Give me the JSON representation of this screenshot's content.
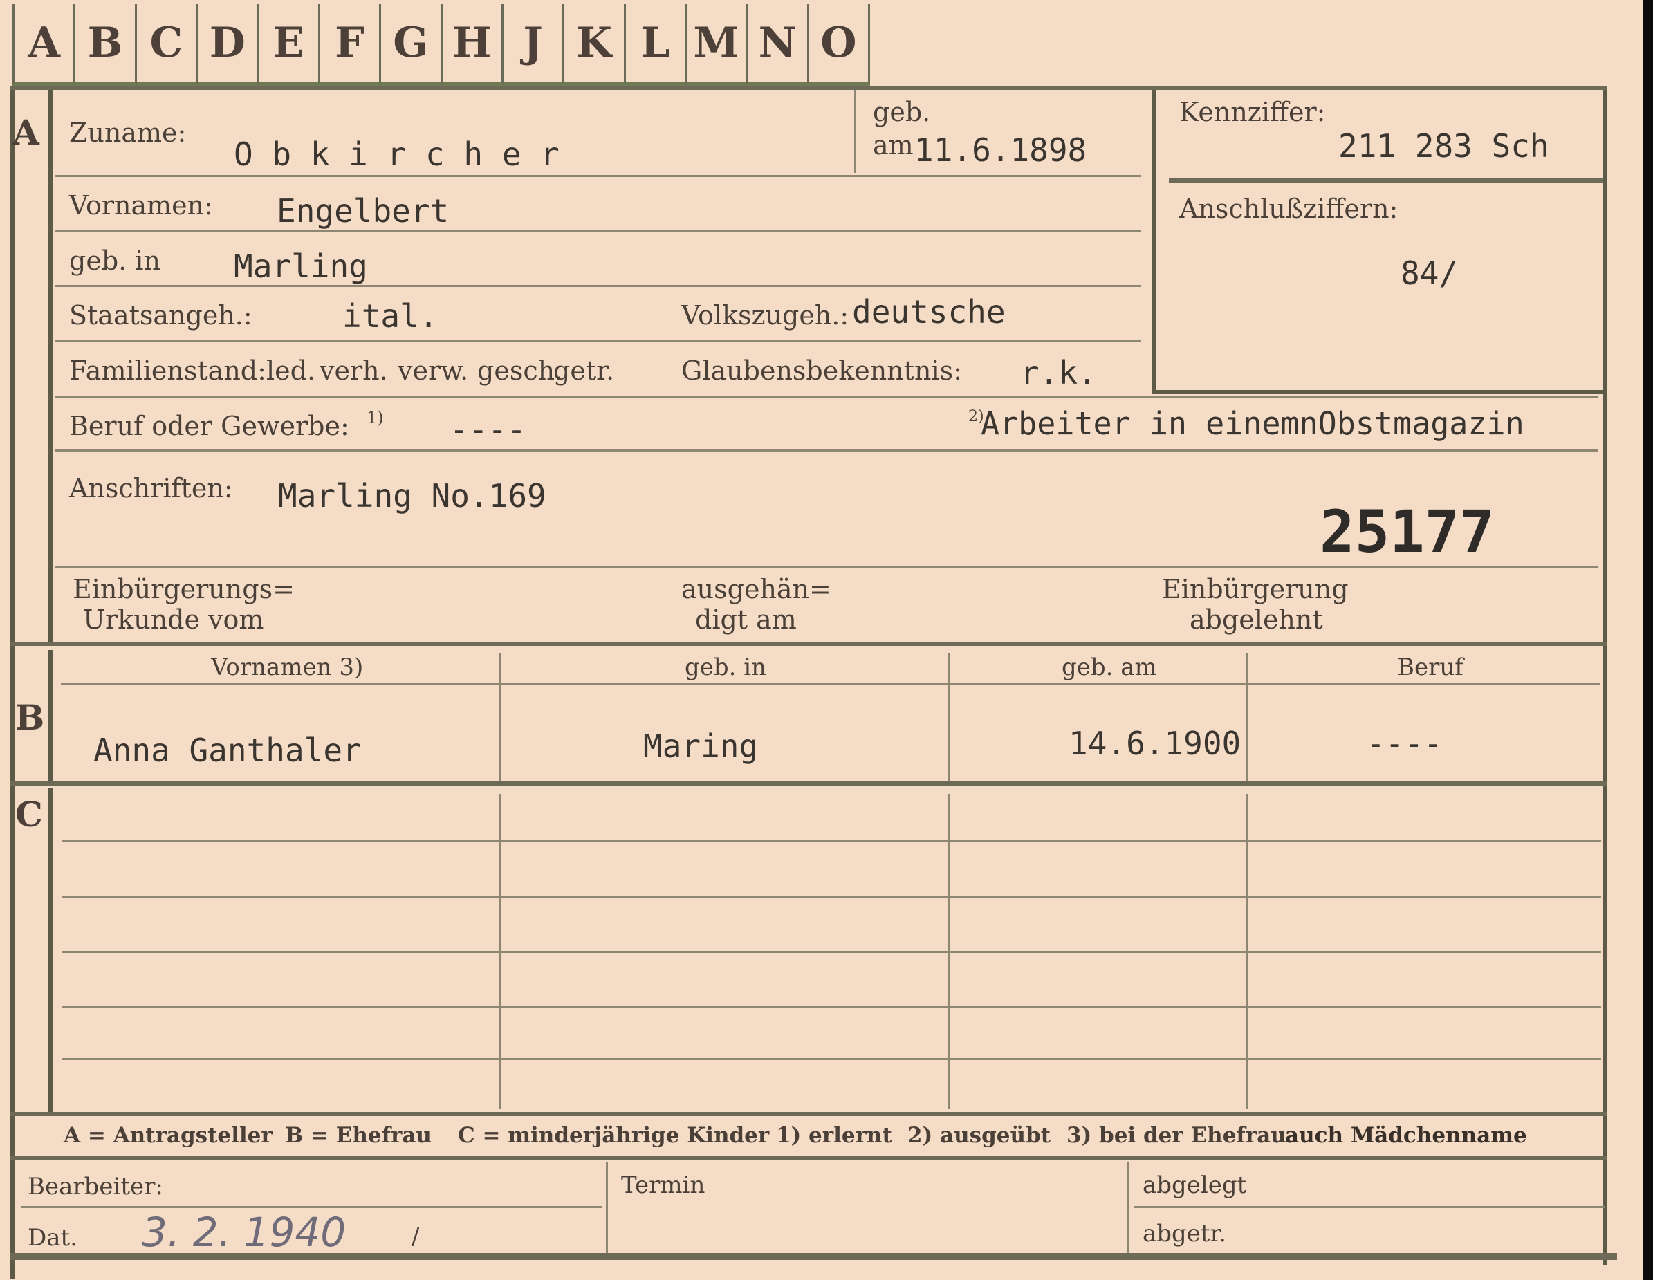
{
  "tabs": [
    "A",
    "B",
    "C",
    "D",
    "E",
    "F",
    "G",
    "H",
    "J",
    "K",
    "L",
    "M",
    "N",
    "O"
  ],
  "section_markers": {
    "a": "A",
    "b": "B",
    "c": "C"
  },
  "fields": {
    "zuname_label": "Zuname:",
    "zuname_value": "O b k i r c h e r",
    "geb_label": "geb.",
    "am_label": "am",
    "geb_am_value": "11.6.1898",
    "kennziffer_label": "Kennziffer:",
    "kennziffer_value": "211 283  Sch",
    "vornamen_label": "Vornamen:",
    "vornamen_value": "Engelbert",
    "anschlussziffern_label": "Anschlußziffern:",
    "anschlussziffern_value": "84/",
    "geb_in_label": "geb. in",
    "geb_in_value": "Marling",
    "staatsangeh_label": "Staatsangeh.:",
    "staatsangeh_value": "ital.",
    "volkszugeh_label": "Volkszugeh.:",
    "volkszugeh_value": "deutsche",
    "familienstand_label": "Familienstand:",
    "familienstand_options": [
      "led.",
      "verh.",
      "verw.",
      "gesch.",
      "getr."
    ],
    "glaubensbekenntnis_label": "Glaubensbekenntnis:",
    "glaubensbekenntnis_value": "r.k.",
    "beruf_label": "Beruf oder Gewerbe:",
    "footnote_1": "1)",
    "beruf_erlernt_value": "----",
    "footnote_2": "2)",
    "beruf_ausgeuebt_value": "Arbeiter in einemnObstmagazin",
    "anschriften_label": "Anschriften:",
    "anschriften_value": "Marling No.169",
    "stamp_number": "25177",
    "einbuergerungsurkunde_line1": "Einbürgerungs=",
    "einbuergerungsurkunde_line2": "Urkunde vom",
    "ausgehaendigt_line1": "ausgehän=",
    "ausgehaendigt_line2": "digt am",
    "einbuergerung_abgelehnt_line1": "Einbürgerung",
    "einbuergerung_abgelehnt_line2": "abgelehnt"
  },
  "table": {
    "headers": [
      "Vornamen 3)",
      "geb. in",
      "geb. am",
      "Beruf"
    ],
    "row_b": {
      "name": "Anna  Ganthaler",
      "geb_in": "Maring",
      "geb_am": "14.6.1900",
      "beruf": "----"
    }
  },
  "legend": {
    "a": "A = Antragsteller",
    "b": "B = Ehefrau",
    "c": "C = minderjährige Kinder",
    "f1": "1) erlernt",
    "f2": "2) ausgeübt",
    "f3_prefix": "3) bei der Ehefrau",
    "f3_suffix": "auch Mädchenname"
  },
  "bottom": {
    "bearbeiter_label": "Bearbeiter:",
    "dat_label": "Dat.",
    "dat_value": "3. 2. 1940",
    "dat_mark": "/",
    "termin_label": "Termin",
    "abgelegt_label": "abgelegt",
    "abgetr_label": "abgetr."
  }
}
